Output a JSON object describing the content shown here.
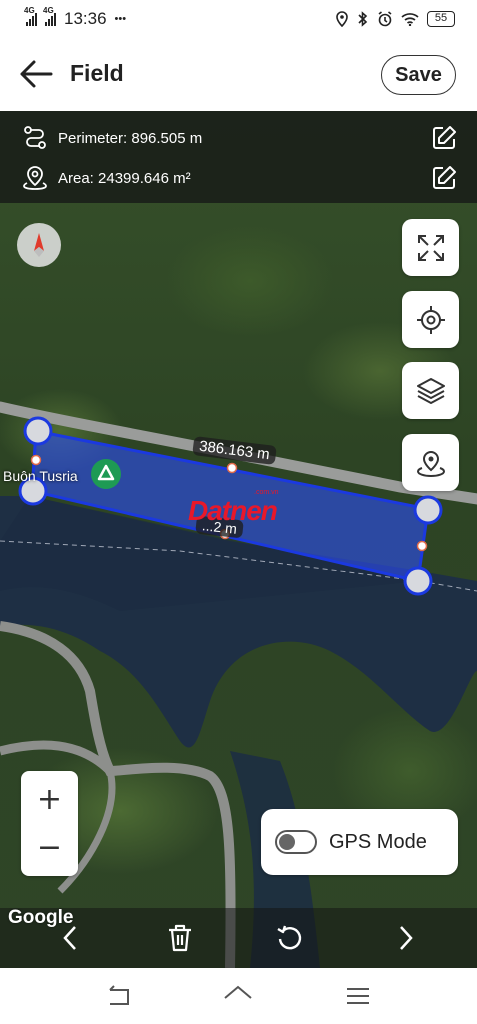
{
  "status_bar": {
    "net1": "4G",
    "net2": "4G",
    "time": "13:36",
    "more": "•••",
    "battery": "55"
  },
  "header": {
    "title": "Field",
    "save_label": "Save"
  },
  "info": {
    "perimeter": "Perimeter: 896.505 m",
    "area": "Area: 24399.646 m²"
  },
  "map": {
    "place_label": "Buôn Tusria",
    "edge_top_label": "386.163 m",
    "edge_bottom_label": "...2 m",
    "polygon_color": "#2b4cf0",
    "vertex_color": "#1b39e0",
    "google_label": "Google",
    "watermark": "Datnen",
    "watermark_small": ".com.vn"
  },
  "controls": {
    "zoom_in": "+",
    "zoom_out": "−",
    "gps_mode_label": "GPS Mode",
    "gps_mode_on": false
  },
  "icons": {
    "back": "arrow-left-icon",
    "perimeter": "route-icon",
    "area": "location-pin-icon",
    "edit": "edit-icon",
    "compass": "compass-icon",
    "fullscreen": "expand-icon",
    "locate": "crosshair-icon",
    "layers": "layers-icon",
    "gps": "gps-pin-icon",
    "delete": "trash-icon",
    "undo": "undo-icon",
    "prev": "chevron-left-icon",
    "next": "chevron-right-icon"
  }
}
